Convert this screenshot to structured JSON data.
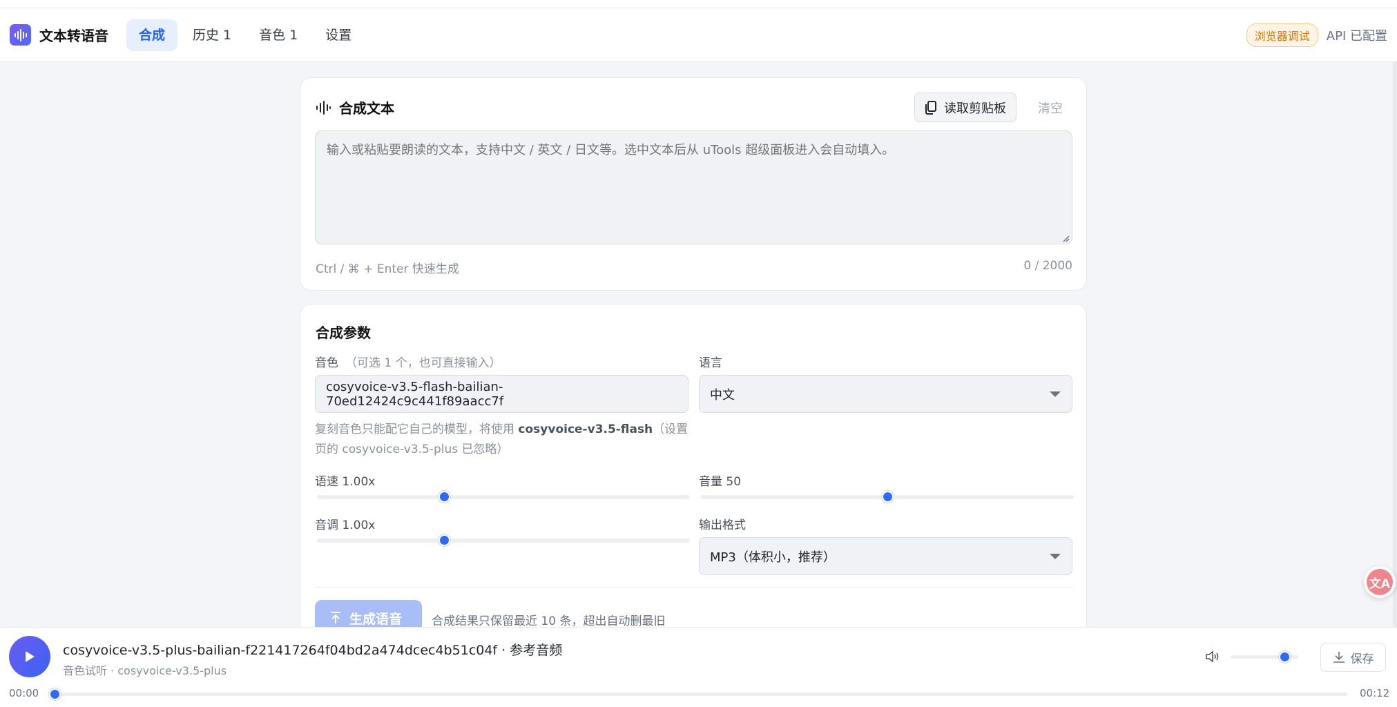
{
  "header": {
    "app_name": "文本转语音",
    "tabs": [
      {
        "label": "合成",
        "active": true
      },
      {
        "label": "历史 1",
        "active": false
      },
      {
        "label": "音色 1",
        "active": false
      },
      {
        "label": "设置",
        "active": false
      }
    ],
    "debug_badge": "浏览器调试",
    "api_status": "API 已配置"
  },
  "text_card": {
    "title": "合成文本",
    "clipboard_button": "读取剪贴板",
    "clear_button": "清空",
    "textarea_value": "",
    "textarea_placeholder": "输入或粘贴要朗读的文本，支持中文 / 英文 / 日文等。选中文本后从 uTools 超级面板进入会自动填入。",
    "shortcut_hint": "Ctrl / ⌘ + Enter 快速生成",
    "char_count": "0 / 2000"
  },
  "params_card": {
    "title": "合成参数",
    "voice": {
      "label": "音色",
      "sublabel": "（可选 1 个，也可直接输入）",
      "value": "cosyvoice-v3.5-flash-bailian-70ed12424c9c441f89aacc7f"
    },
    "voice_note_pre": "复刻音色只能配它自己的模型，将使用 ",
    "voice_note_model": "cosyvoice-v3.5-flash",
    "voice_note_post": "（设置页的 cosyvoice-v3.5-plus 已忽略）",
    "language": {
      "label": "语言",
      "value": "中文"
    },
    "speed": {
      "label": "语速 1.00x",
      "fraction": 0.34
    },
    "volume": {
      "label": "音量 50",
      "value": 50,
      "fraction": 0.5
    },
    "pitch": {
      "label": "音调 1.00x",
      "fraction": 0.34
    },
    "format": {
      "label": "输出格式",
      "value": "MP3（体积小，推荐）"
    },
    "generate_button": "生成语音",
    "retention_note": "合成结果只保留最近 10 条，超出自动删最旧"
  },
  "player": {
    "title": "cosyvoice-v3.5-plus-bailian-f221417264f04bd2a474dcec4b51c04f · 参考音频",
    "subtitle": "音色试听 · cosyvoice-v3.5-plus",
    "volume_fraction": 0.8,
    "save_button": "保存",
    "current_time": "00:00",
    "total_time": "00:12",
    "progress_fraction": 0.0
  },
  "floating_button_label": "文A",
  "colors": {
    "accent": "#2563eb",
    "debug_badge": "#d97706",
    "generate_disabled": "#a9bdf7"
  }
}
